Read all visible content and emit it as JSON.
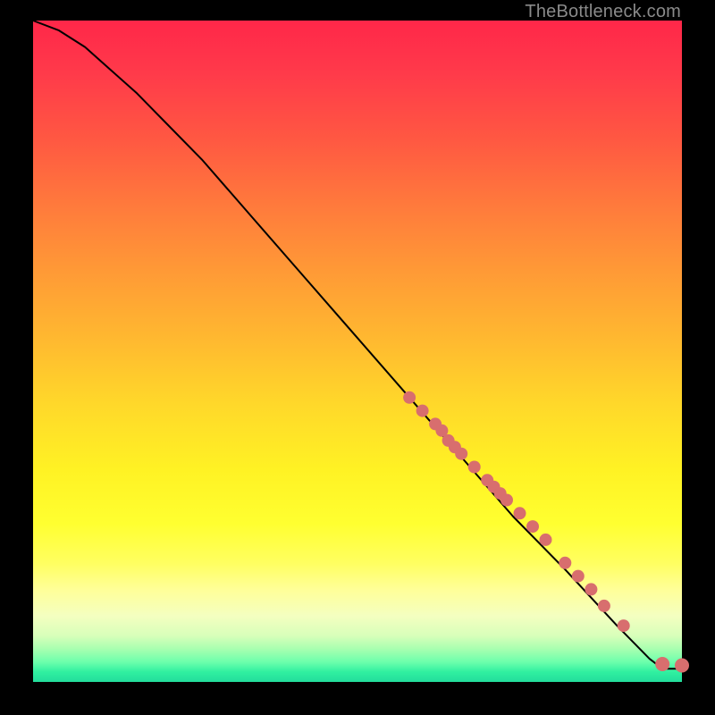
{
  "watermark": "TheBottleneck.com",
  "chart_data": {
    "type": "line",
    "title": "",
    "xlabel": "",
    "ylabel": "",
    "xlim": [
      0,
      100
    ],
    "ylim": [
      0,
      100
    ],
    "series": [
      {
        "name": "curve",
        "kind": "line",
        "x": [
          0,
          4,
          8,
          12,
          16,
          20,
          26,
          34,
          42,
          50,
          58,
          66,
          74,
          82,
          90,
          95,
          97,
          100
        ],
        "y": [
          100,
          98.5,
          96,
          92.5,
          89,
          85,
          79,
          70,
          61,
          52,
          43,
          34,
          25,
          17,
          8.5,
          3.5,
          2,
          2
        ]
      },
      {
        "name": "points",
        "kind": "scatter",
        "x": [
          58,
          60,
          62,
          63,
          64,
          65,
          66,
          68,
          70,
          71,
          72,
          73,
          75,
          77,
          79,
          82,
          84,
          86,
          88,
          91,
          97,
          100
        ],
        "y": [
          43,
          41,
          39,
          38,
          36.5,
          35.5,
          34.5,
          32.5,
          30.5,
          29.5,
          28.5,
          27.5,
          25.5,
          23.5,
          21.5,
          18,
          16,
          14,
          11.5,
          8.5,
          2.7,
          2.5
        ]
      }
    ]
  }
}
